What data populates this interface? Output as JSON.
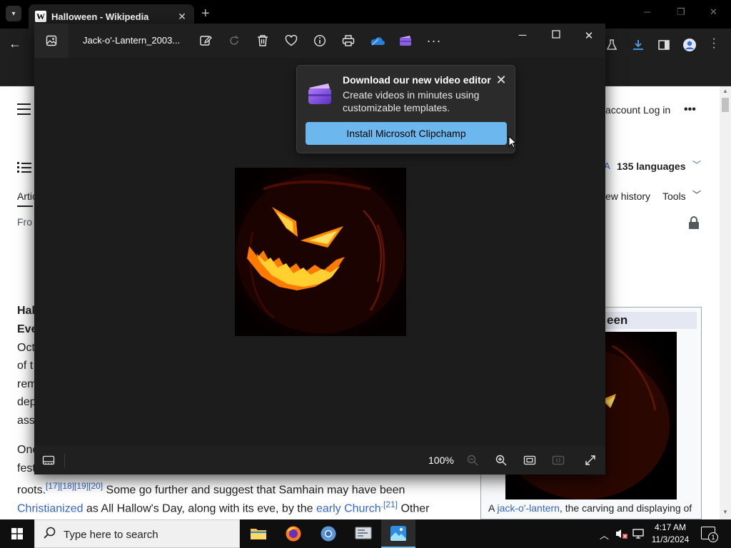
{
  "browser": {
    "tab_title": "Halloween - Wikipedia",
    "tab_favicon": "W",
    "new_tab": "+",
    "tab_close": "✕"
  },
  "wiki": {
    "account_link": "account",
    "login_link": "Log in",
    "more": "•••",
    "languages": "135 languages",
    "view_history": "ew history",
    "tools": "Tools",
    "tab_article": "Artic",
    "from": "Fro",
    "left_fragments": [
      "Hal",
      "Eve",
      "Oct",
      "of t",
      "rem",
      "dep",
      "ass",
      "One",
      "fest"
    ],
    "roots_line_prefix": "roots.",
    "roots_refs": "[17][18][19][20]",
    "roots_line_rest": " Some go further and suggest that Samhain may have been",
    "christ_line_link": "Christianized",
    "christ_line_mid": " as All Hallow's Day, along with its eve, by the ",
    "christ_line_link2": "early Church",
    "christ_line_ref": ".[21]",
    "christ_line_end": " Other",
    "infobox_title": "een",
    "infobox_caption_a": "A ",
    "infobox_caption_link": "jack-o'-lantern",
    "infobox_caption_rest": ", the carving and displaying of"
  },
  "viewer": {
    "filename": "Jack-o'-Lantern_2003...",
    "zoom_level": "100%",
    "toolbar": [
      "edit-image-icon",
      "rotate-icon",
      "delete-icon",
      "favorite-icon",
      "info-icon",
      "print-icon",
      "onedrive-icon",
      "clipchamp-icon",
      "more-icon"
    ]
  },
  "promo": {
    "title": "Download our new video editor",
    "description": "Create videos in minutes using customizable templates.",
    "button": "Install Microsoft Clipchamp",
    "close": "✕"
  },
  "taskbar": {
    "search_placeholder": "Type here to search",
    "time": "4:17 AM",
    "date": "11/3/2024",
    "notification_count": "1",
    "apps": [
      "file-explorer",
      "firefox",
      "chromium",
      "system-settings",
      "photos"
    ]
  },
  "colors": {
    "accent": "#6cb8ee",
    "link": "#3366cc",
    "viewer_bg": "#1c1c1c"
  }
}
